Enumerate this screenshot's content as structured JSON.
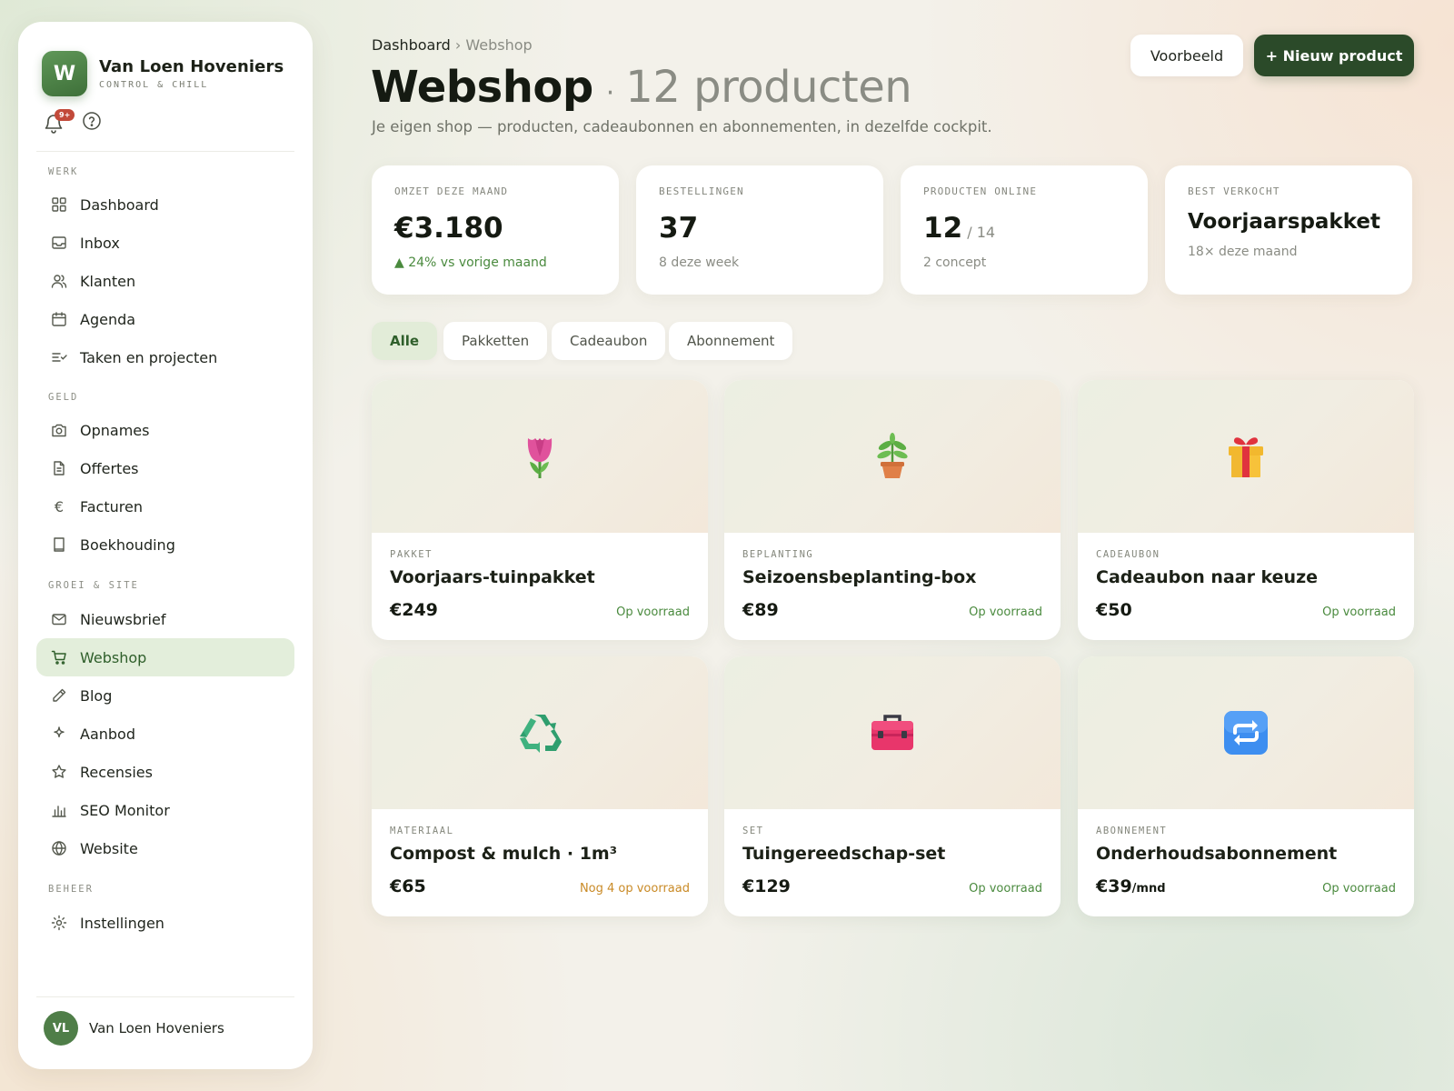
{
  "brand": {
    "logo_letter": "W",
    "name": "Van Loen Hoveniers",
    "tagline": "CONTROL & CHILL"
  },
  "notifications": {
    "badge": "9+"
  },
  "sidebar": {
    "sections": [
      "WERK",
      "GELD",
      "GROEI & SITE",
      "BEHEER"
    ],
    "items": [
      {
        "label": "Dashboard",
        "icon": "grid-icon"
      },
      {
        "label": "Inbox",
        "icon": "inbox-icon"
      },
      {
        "label": "Klanten",
        "icon": "users-icon"
      },
      {
        "label": "Agenda",
        "icon": "calendar-icon"
      },
      {
        "label": "Taken en projecten",
        "icon": "tasks-icon"
      },
      {
        "label": "Opnames",
        "icon": "camera-icon"
      },
      {
        "label": "Offertes",
        "icon": "document-icon"
      },
      {
        "label": "Facturen",
        "icon": "euro-icon"
      },
      {
        "label": "Boekhouding",
        "icon": "book-icon"
      },
      {
        "label": "Nieuwsbrief",
        "icon": "mail-icon"
      },
      {
        "label": "Webshop",
        "icon": "cart-icon",
        "active": true
      },
      {
        "label": "Blog",
        "icon": "pencil-icon"
      },
      {
        "label": "Aanbod",
        "icon": "sparkle-icon"
      },
      {
        "label": "Recensies",
        "icon": "star-icon"
      },
      {
        "label": "SEO Monitor",
        "icon": "bar-chart-icon"
      },
      {
        "label": "Website",
        "icon": "globe-icon"
      },
      {
        "label": "Instellingen",
        "icon": "settings-icon"
      }
    ],
    "user": {
      "initials": "VL",
      "name": "Van Loen Hoveniers"
    }
  },
  "header": {
    "breadcrumb_root": "Dashboard",
    "breadcrumb_sep": "›",
    "breadcrumb_current": "Webshop",
    "title": "Webshop",
    "title_dot": "·",
    "count_label": "12 producten",
    "subtitle": "Je eigen shop — producten, cadeaubonnen en abonnementen, in dezelfde cockpit.",
    "preview_button": "Voorbeeld",
    "new_button": "+ Nieuw product"
  },
  "stats": [
    {
      "label": "OMZET DEZE MAAND",
      "value": "€3.180",
      "note": "▲ 24% vs vorige maand"
    },
    {
      "label": "BESTELLINGEN",
      "value": "37",
      "note": "8 deze week"
    },
    {
      "label": "PRODUCTEN ONLINE",
      "value": "12",
      "value_suffix": " / 14",
      "note": "2 concept"
    },
    {
      "label": "BEST VERKOCHT",
      "value": "Voorjaarspakket",
      "note": "18× deze maand"
    }
  ],
  "filters": [
    "Alle",
    "Pakketten",
    "Cadeaubon",
    "Abonnement"
  ],
  "products": [
    {
      "category": "PAKKET",
      "name": "Voorjaars-tuinpakket",
      "price": "€249",
      "price_unit": "",
      "stock": "Op voorraad",
      "icon": "tulip-icon"
    },
    {
      "category": "BEPLANTING",
      "name": "Seizoensbeplanting-box",
      "price": "€89",
      "price_unit": "",
      "stock": "Op voorraad",
      "icon": "potted-plant-icon"
    },
    {
      "category": "CADEAUBON",
      "name": "Cadeaubon naar keuze",
      "price": "€50",
      "price_unit": "",
      "stock": "Op voorraad",
      "icon": "gift-icon"
    },
    {
      "category": "MATERIAAL",
      "name": "Compost & mulch · 1m³",
      "price": "€65",
      "price_unit": "",
      "stock": "Nog 4 op voorraad",
      "icon": "recycle-icon"
    },
    {
      "category": "SET",
      "name": "Tuingereedschap-set",
      "price": "€129",
      "price_unit": "",
      "stock": "Op voorraad",
      "icon": "toolbox-icon"
    },
    {
      "category": "ABONNEMENT",
      "name": "Onderhoudsabonnement",
      "price": "€39",
      "price_unit": "/mnd",
      "stock": "Op voorraad",
      "icon": "repeat-icon"
    }
  ],
  "colors": {
    "accent": "#2b4a29",
    "active_bg": "#e3eedb",
    "in_stock": "#4a8a3e",
    "low_stock": "#c98a26",
    "badge": "#c24a3a"
  }
}
